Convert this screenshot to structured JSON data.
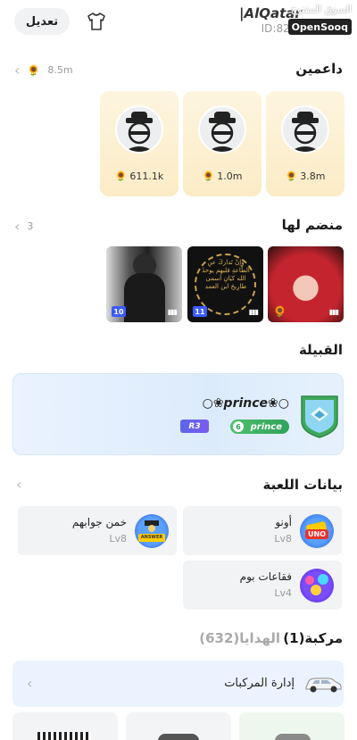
{
  "header": {
    "edit_label": "تعديل",
    "username": "|AlQatar",
    "user_id": "ID:8278",
    "watermark_arabic": "السوق المفتوح",
    "watermark_brand": "OpenSooq"
  },
  "supporters": {
    "title": "داعمين",
    "count": "8.5m",
    "items": [
      {
        "value": "3.8m"
      },
      {
        "value": "1.0m"
      },
      {
        "value": "611.1k"
      }
    ]
  },
  "joined": {
    "title": "منضم لها",
    "count": "3",
    "items": [
      {
        "badge": ""
      },
      {
        "badge": "11",
        "caption": "وَإنْ تَداركَ عنِ الطّاعةِ قلبهم يوحدُ الله كيَانِ أسمى طارِيحَ ابن العمد"
      },
      {
        "badge": "10"
      }
    ]
  },
  "tribe": {
    "title": "القبيلة",
    "name": "○❀prince❀○",
    "badge_text": "prince",
    "badge_num": "6",
    "rank": "R3"
  },
  "games": {
    "title": "بيانات اللعبة",
    "items": [
      {
        "name": "أونو",
        "level": "Lv8",
        "icon": "uno-game-icon"
      },
      {
        "name": "خمن جوابهم",
        "level": "Lv8",
        "icon": "guess-answer-game-icon"
      },
      {
        "name": "فقاعات بوم",
        "level": "Lv4",
        "icon": "bubble-boom-game-icon"
      }
    ]
  },
  "tabs": {
    "vehicles": "مركبة(1)",
    "gifts": "الهدايا(632)"
  },
  "vehicles": {
    "manage_label": "إدارة المركبات"
  }
}
